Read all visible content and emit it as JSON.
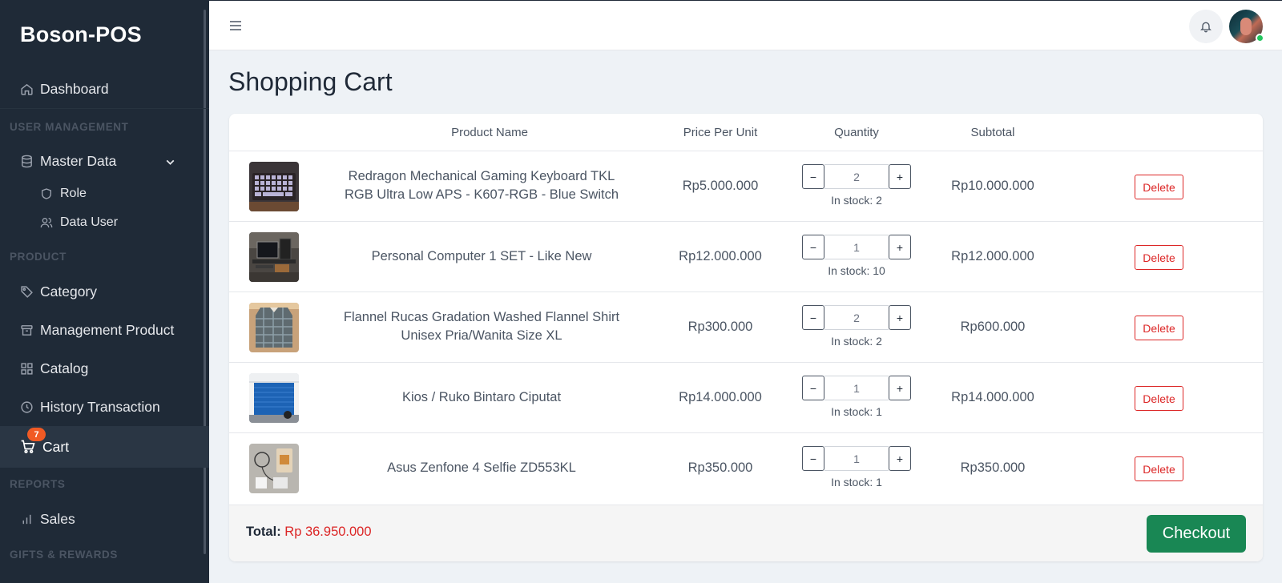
{
  "app": {
    "brand": "Boson-POS"
  },
  "sidebar": {
    "dashboard": "Dashboard",
    "sections": {
      "user_management": "USER MANAGEMENT",
      "product": "PRODUCT",
      "reports": "REPORTS",
      "gifts": "GIFTS & REWARDS"
    },
    "master_data": "Master Data",
    "role": "Role",
    "data_user": "Data User",
    "category": "Category",
    "management_product": "Management Product",
    "catalog": "Catalog",
    "history_transaction": "History Transaction",
    "cart": "Cart",
    "cart_badge": "7",
    "sales": "Sales"
  },
  "page": {
    "title": "Shopping Cart"
  },
  "table": {
    "headers": {
      "product_name": "Product Name",
      "price_per_unit": "Price Per Unit",
      "quantity": "Quantity",
      "subtotal": "Subtotal"
    },
    "rows": [
      {
        "name": "Redragon Mechanical Gaming Keyboard TKL RGB Ultra Low APS - K607-RGB - Blue Switch",
        "price": "Rp5.000.000",
        "qty": "2",
        "stock": "In stock: 2",
        "subtotal": "Rp10.000.000",
        "delete": "Delete",
        "thumb": "keyboard"
      },
      {
        "name": "Personal Computer 1 SET - Like New",
        "price": "Rp12.000.000",
        "qty": "1",
        "stock": "In stock: 10",
        "subtotal": "Rp12.000.000",
        "delete": "Delete",
        "thumb": "computer"
      },
      {
        "name": "Flannel Rucas Gradation Washed Flannel Shirt Unisex Pria/Wanita Size XL",
        "price": "Rp300.000",
        "qty": "2",
        "stock": "In stock: 2",
        "subtotal": "Rp600.000",
        "delete": "Delete",
        "thumb": "shirt"
      },
      {
        "name": "Kios / Ruko Bintaro Ciputat",
        "price": "Rp14.000.000",
        "qty": "1",
        "stock": "In stock: 1",
        "subtotal": "Rp14.000.000",
        "delete": "Delete",
        "thumb": "shop"
      },
      {
        "name": "Asus Zenfone 4 Selfie ZD553KL",
        "price": "Rp350.000",
        "qty": "1",
        "stock": "In stock: 1",
        "subtotal": "Rp350.000",
        "delete": "Delete",
        "thumb": "phone"
      }
    ],
    "minus": "−",
    "plus": "+"
  },
  "footer": {
    "total_label": "Total:",
    "total_value": "Rp 36.950.000",
    "checkout": "Checkout"
  },
  "icons": {
    "menu": "hamburger-icon",
    "bell": "bell-icon",
    "cart": "cart-icon"
  },
  "colors": {
    "sidebar_bg": "#1f2a37",
    "accent_danger": "#dc2626",
    "checkout_green": "#198754",
    "badge": "#f15a24"
  }
}
